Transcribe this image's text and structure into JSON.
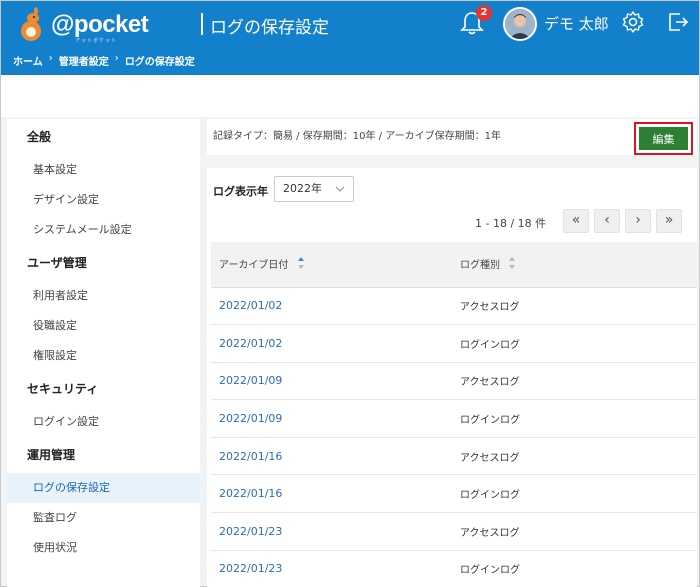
{
  "header": {
    "logo_text": "@pocket",
    "logo_sub": "アットポケット",
    "title": "ログの保存設定",
    "notification_count": "2",
    "user_name": "デモ 太郎",
    "color": "#1380cc"
  },
  "breadcrumb": [
    "ホーム",
    "管理者設定",
    "ログの保存設定"
  ],
  "breadcrumb_sep": "›",
  "sidebar": {
    "groups": [
      {
        "label": "全般",
        "items": [
          "基本設定",
          "デザイン設定",
          "システムメール設定"
        ]
      },
      {
        "label": "ユーザ管理",
        "items": [
          "利用者設定",
          "役職設定",
          "権限設定"
        ]
      },
      {
        "label": "セキュリティ",
        "items": [
          "ログイン設定"
        ]
      },
      {
        "label": "運用管理",
        "items": [
          "ログの保存設定",
          "監査ログ",
          "使用状況"
        ]
      }
    ],
    "active_item": "ログの保存設定"
  },
  "info": {
    "text": "記録タイプ：簡易 / 保存期間：10年 / アーカイブ保存期間：1年",
    "edit_label": "編集"
  },
  "filter": {
    "year_label": "ログ表示年",
    "year_value": "2022年"
  },
  "pager": {
    "text": "1 - 18 / 18 件",
    "first_icon": "«",
    "prev_icon": "‹",
    "next_icon": "›",
    "last_icon": "»"
  },
  "table": {
    "columns": [
      "アーカイブ日付",
      "ログ種別"
    ],
    "rows": [
      [
        "2022/01/02",
        "アクセスログ"
      ],
      [
        "2022/01/02",
        "ログインログ"
      ],
      [
        "2022/01/09",
        "アクセスログ"
      ],
      [
        "2022/01/09",
        "ログインログ"
      ],
      [
        "2022/01/16",
        "アクセスログ"
      ],
      [
        "2022/01/16",
        "ログインログ"
      ],
      [
        "2022/01/23",
        "アクセスログ"
      ],
      [
        "2022/01/23",
        "ログインログ"
      ]
    ]
  }
}
